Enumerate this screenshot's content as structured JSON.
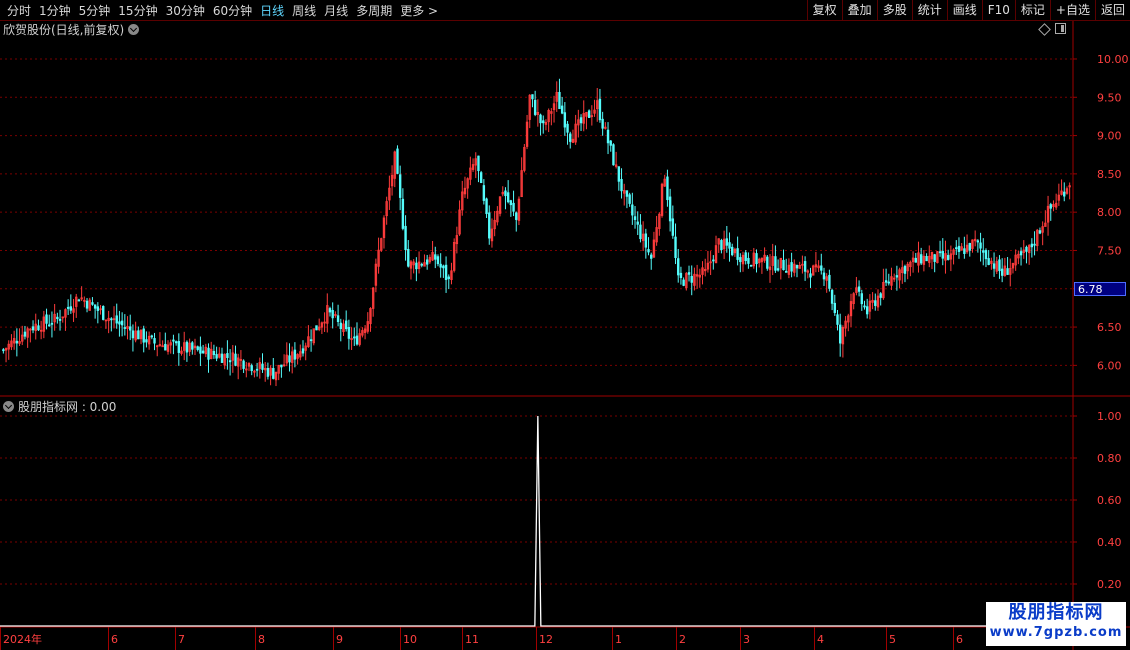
{
  "toolbar": {
    "periods": [
      "分时",
      "1分钟",
      "5分钟",
      "15分钟",
      "30分钟",
      "60分钟",
      "日线",
      "周线",
      "月线",
      "多周期",
      "更多"
    ],
    "active_period": "日线",
    "more_chevron": ">",
    "right_buttons": [
      "复权",
      "叠加",
      "多股",
      "统计",
      "画线",
      "F10",
      "标记",
      "+自选",
      "返回"
    ]
  },
  "main_panel": {
    "title": "欣贺股份(日线,前复权)",
    "price_tag": "6.78",
    "y_ticks": [
      "10.00",
      "9.50",
      "9.00",
      "8.50",
      "8.00",
      "7.50",
      "7.00",
      "6.50",
      "6.00"
    ],
    "y_tick_values": [
      10.0,
      9.5,
      9.0,
      8.5,
      8.0,
      7.5,
      7.0,
      6.5,
      6.0
    ]
  },
  "indicator_panel": {
    "title": "股朋指标网 : 0.00",
    "y_ticks": [
      "1.00",
      "0.80",
      "0.60",
      "0.40",
      "0.20"
    ],
    "y_tick_values": [
      1.0,
      0.8,
      0.6,
      0.4,
      0.2
    ]
  },
  "x_axis": {
    "labels": [
      "2024年",
      "6",
      "7",
      "8",
      "9",
      "10",
      "11",
      "12",
      "1",
      "2",
      "3",
      "4",
      "5",
      "6"
    ]
  },
  "colors": {
    "up": "#ff3c3c",
    "down": "#54fcfc",
    "grid": "#7a0000",
    "frame": "#a00000",
    "active": "#5fd7ff",
    "price_tag_bg": "#000080"
  },
  "watermark": {
    "line1": "股朋指标网",
    "line2": "www.7gpzb.com"
  },
  "chart_data": {
    "type": "candlestick",
    "ylim": [
      5.6,
      10.3
    ],
    "anchors": [
      [
        0,
        6.2
      ],
      [
        10,
        6.5
      ],
      [
        20,
        6.6
      ],
      [
        28,
        6.9
      ],
      [
        40,
        6.6
      ],
      [
        55,
        6.3
      ],
      [
        70,
        6.2
      ],
      [
        85,
        6.1
      ],
      [
        100,
        5.9
      ],
      [
        110,
        6.2
      ],
      [
        120,
        6.7
      ],
      [
        130,
        6.3
      ],
      [
        135,
        6.6
      ],
      [
        140,
        7.7
      ],
      [
        145,
        8.7
      ],
      [
        150,
        7.3
      ],
      [
        160,
        7.4
      ],
      [
        165,
        7.1
      ],
      [
        170,
        8.2
      ],
      [
        175,
        8.7
      ],
      [
        180,
        7.7
      ],
      [
        185,
        8.3
      ],
      [
        190,
        7.9
      ],
      [
        195,
        9.5
      ],
      [
        200,
        9.1
      ],
      [
        205,
        9.5
      ],
      [
        210,
        9.0
      ],
      [
        220,
        9.4
      ],
      [
        230,
        8.2
      ],
      [
        240,
        7.4
      ],
      [
        245,
        8.5
      ],
      [
        250,
        7.1
      ],
      [
        260,
        7.2
      ],
      [
        265,
        7.6
      ],
      [
        275,
        7.4
      ],
      [
        290,
        7.3
      ],
      [
        305,
        7.2
      ],
      [
        310,
        6.3
      ],
      [
        315,
        7.0
      ],
      [
        320,
        6.7
      ],
      [
        330,
        7.2
      ],
      [
        340,
        7.4
      ],
      [
        350,
        7.4
      ],
      [
        360,
        7.6
      ],
      [
        370,
        7.2
      ],
      [
        380,
        7.5
      ],
      [
        387,
        8.0
      ],
      [
        395,
        8.4
      ]
    ],
    "indicator": {
      "spike_index": 198,
      "spike_value": 1.0,
      "baseline": 0.0
    }
  }
}
